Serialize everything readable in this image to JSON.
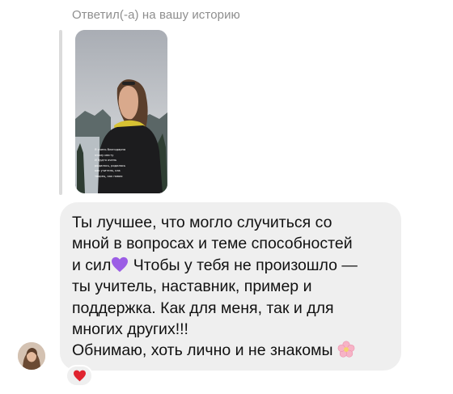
{
  "reply_header": "Ответил(-а) на вашу историю",
  "story": {
    "caption_lines": [
      "Я очень благодарна",
      "этому месту",
      "И будто очень",
      "родилась, родилась",
      "как учитель, как",
      "творец, как новая"
    ]
  },
  "message": {
    "text_part1": "Ты лучшее, что могло случиться со\nмной в вопросах и теме способностей\nи сил",
    "emoji1": "purple-heart",
    "text_part2": " Чтобы у тебя не произошло —\nты учитель, наставник, пример и\nподдержка. Как для меня, так и для\nмногих других!!!\nОбнимаю, хоть лично и не знакомы ",
    "emoji2": "cherry-blossom"
  },
  "reaction": {
    "emoji": "red-heart",
    "color": "#e0242f"
  },
  "colors": {
    "bubble_bg": "#efefef",
    "header_text": "#8e8e8e",
    "quote_bar": "#dbdbdb",
    "purple_heart": "#9b5de5"
  }
}
